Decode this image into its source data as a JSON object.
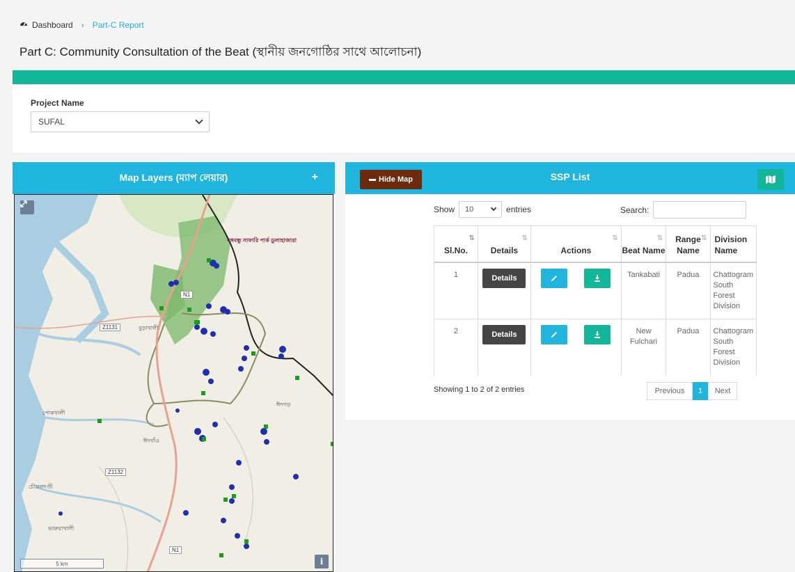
{
  "breadcrumb": {
    "home": "Dashboard",
    "separator": "›",
    "current": "Part-C Report"
  },
  "page_title": "Part C: Community Consultation of the Beat (স্থানীয় জনগোষ্ঠির সাথে আলোচনা)",
  "filter": {
    "label": "Project Name",
    "selected": "SUFAL"
  },
  "map_panel": {
    "title": "Map Layers (ম্যাপ লেয়ার)",
    "add_icon": "+",
    "road_labels": [
      "Z1131",
      "Z1132",
      "N1",
      "N1"
    ],
    "place_labels": [
      "বুড়াখালী",
      "পোকখালী",
      "ঈদগাঁও",
      "ঈদগড়",
      "চৌফলদণ্ডী",
      "ভারুয়াখালী",
      "বঙ্গবন্ধু সাফারি পার্ক ডুলাহাজারা"
    ],
    "scale_label": "5 km",
    "info_icon": "i",
    "colors": {
      "markers_blue": "#1f2fb0",
      "markers_green": "#1a9e1a",
      "park_green": "#7ab86a"
    }
  },
  "list_panel": {
    "title": "SSP List",
    "hide_map_label": "Hide Map",
    "show_label": "Show",
    "page_length": "10",
    "entries_label": "entries",
    "search_label": "Search:",
    "columns": [
      "Sl.No.",
      "Details",
      "Actions",
      "Beat Name",
      "Range Name",
      "Division Name"
    ],
    "rows": [
      {
        "sl": "1",
        "details": "Details",
        "beat": "Tankabati",
        "range": "Padua",
        "division": "Chattogram South Forest Division"
      },
      {
        "sl": "2",
        "details": "Details",
        "beat": "New Fulchari",
        "range": "Padua",
        "division": "Chattogram South Forest Division"
      }
    ],
    "info": "Showing 1 to 2 of 2 entries",
    "pagination": {
      "previous": "Previous",
      "current": "1",
      "next": "Next"
    }
  }
}
